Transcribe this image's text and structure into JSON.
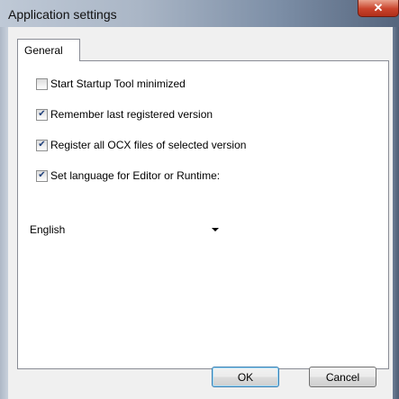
{
  "window": {
    "title": "Application settings",
    "close_glyph": "✕"
  },
  "tabs": [
    {
      "label": "General"
    }
  ],
  "options": [
    {
      "label": "Start Startup Tool minimized",
      "checked": false
    },
    {
      "label": "Remember last registered version",
      "checked": true
    },
    {
      "label": "Register all OCX files of selected version",
      "checked": true
    },
    {
      "label": "Set language for Editor or Runtime:",
      "checked": true
    }
  ],
  "language": {
    "selected": "English"
  },
  "buttons": {
    "ok": "OK",
    "cancel": "Cancel"
  },
  "icons": {
    "check": "check-icon",
    "dropdown": "chevron-down-icon",
    "close": "close-icon"
  },
  "colors": {
    "tab_border": "#898c95",
    "default_button_border": "#3c7fb1",
    "close_button": "#c9432b"
  }
}
